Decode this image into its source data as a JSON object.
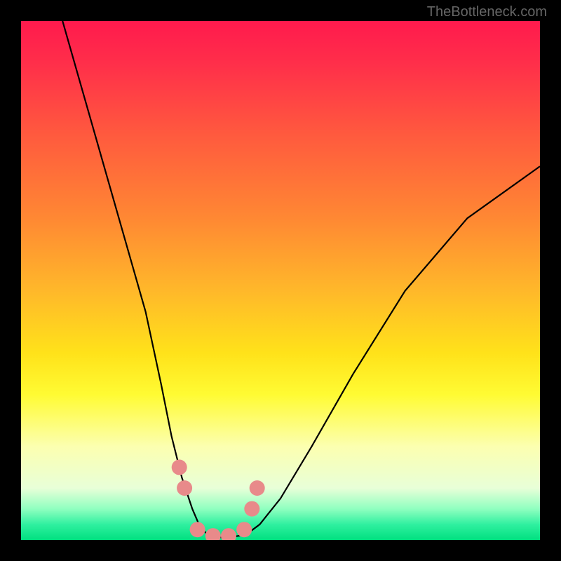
{
  "watermark": "TheBottleneck.com",
  "chart_data": {
    "type": "line",
    "title": "",
    "xlabel": "",
    "ylabel": "",
    "xlim": [
      0,
      100
    ],
    "ylim": [
      0,
      100
    ],
    "series": [
      {
        "name": "curve",
        "x": [
          8,
          12,
          16,
          20,
          24,
          27,
          29,
          31,
          33,
          34.5,
          36,
          38,
          40,
          42,
          44,
          46,
          50,
          56,
          64,
          74,
          86,
          100
        ],
        "values": [
          100,
          86,
          72,
          58,
          44,
          30,
          20,
          12,
          6,
          2.5,
          1,
          0.5,
          0.5,
          0.8,
          1.5,
          3,
          8,
          18,
          32,
          48,
          62,
          72
        ]
      }
    ],
    "markers": {
      "name": "highlight-points",
      "x": [
        30.5,
        31.5,
        34,
        37,
        40,
        43,
        44.5,
        45.5
      ],
      "values": [
        14,
        10,
        2,
        0.8,
        0.8,
        2,
        6,
        10
      ],
      "color": "#e88a8a"
    },
    "gradient_stops": [
      {
        "pos": 0,
        "color": "#ff1a4d"
      },
      {
        "pos": 22,
        "color": "#ff5a3e"
      },
      {
        "pos": 52,
        "color": "#ffb82a"
      },
      {
        "pos": 72,
        "color": "#fffb33"
      },
      {
        "pos": 90,
        "color": "#e8ffd8"
      },
      {
        "pos": 100,
        "color": "#00e080"
      }
    ]
  }
}
